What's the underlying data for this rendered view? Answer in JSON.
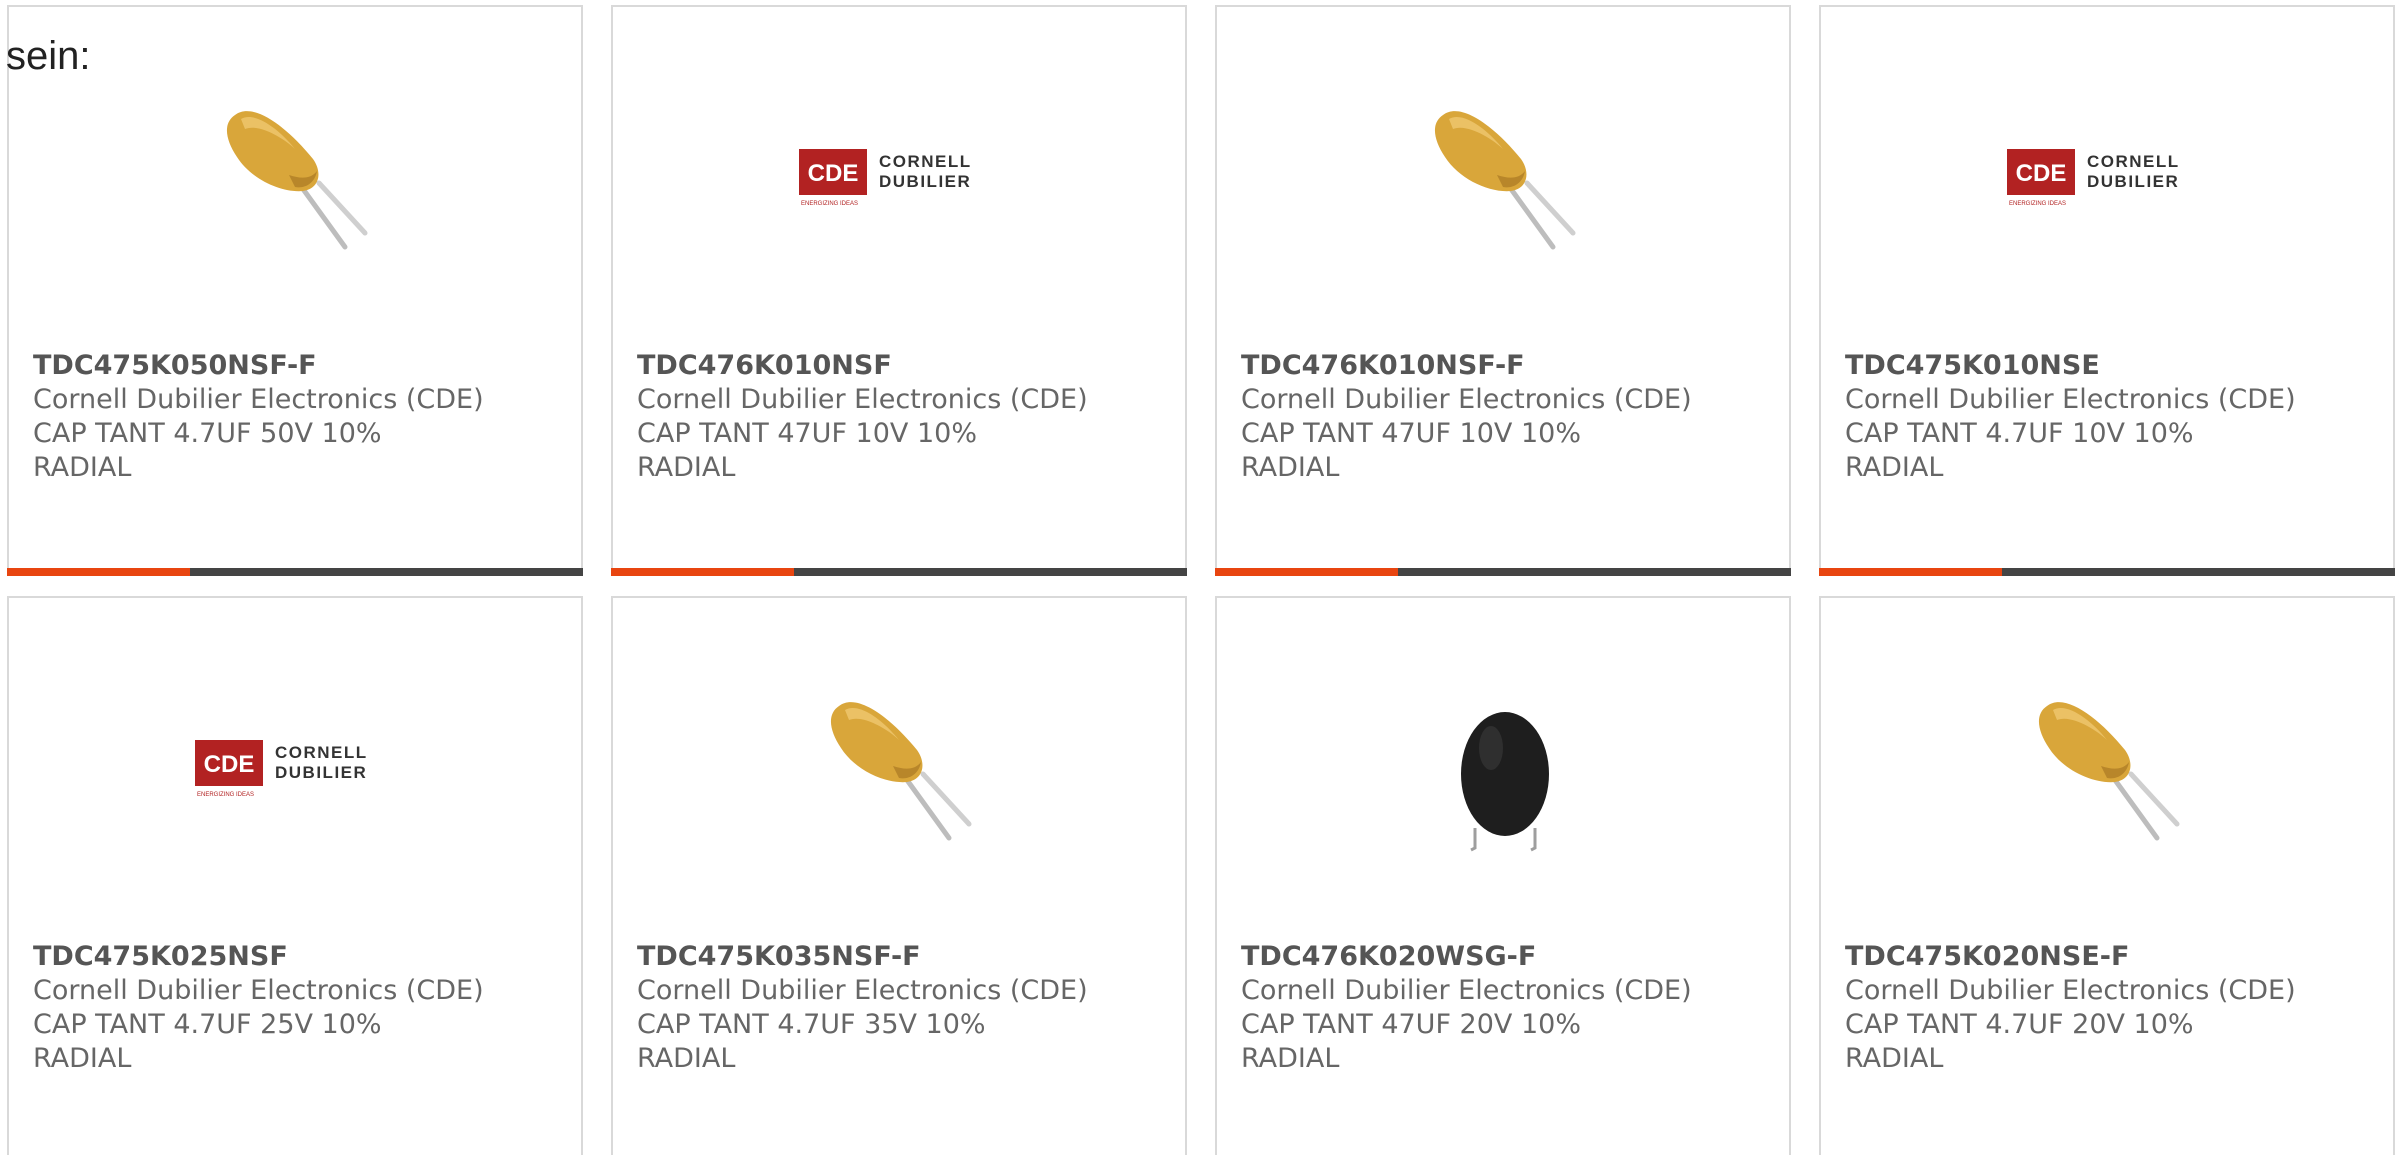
{
  "intro_text": "sein:",
  "colors": {
    "accent": "#e84510",
    "bar": "#444444",
    "border": "#d9d9d9",
    "text": "#666666",
    "cde_red": "#b22222"
  },
  "cards": [
    {
      "part": "TDC475K050NSF-F",
      "manufacturer": "Cornell Dubilier Electronics (CDE)",
      "description": "CAP TANT 4.7UF 50V 10%\nRADIAL",
      "image": "tantalum-capacitor-icon"
    },
    {
      "part": "TDC476K010NSF",
      "manufacturer": "Cornell Dubilier Electronics (CDE)",
      "description": "CAP TANT 47UF 10V 10%\nRADIAL",
      "image": "cde-logo-icon"
    },
    {
      "part": "TDC476K010NSF-F",
      "manufacturer": "Cornell Dubilier Electronics (CDE)",
      "description": "CAP TANT 47UF 10V 10%\nRADIAL",
      "image": "tantalum-capacitor-icon"
    },
    {
      "part": "TDC475K010NSE",
      "manufacturer": "Cornell Dubilier Electronics (CDE)",
      "description": "CAP TANT 4.7UF 10V 10%\nRADIAL",
      "image": "cde-logo-icon"
    },
    {
      "part": "TDC475K025NSF",
      "manufacturer": "Cornell Dubilier Electronics (CDE)",
      "description": "CAP TANT 4.7UF 25V 10%\nRADIAL",
      "image": "cde-logo-icon"
    },
    {
      "part": "TDC475K035NSF-F",
      "manufacturer": "Cornell Dubilier Electronics (CDE)",
      "description": "CAP TANT 4.7UF 35V 10%\nRADIAL",
      "image": "tantalum-capacitor-icon"
    },
    {
      "part": "TDC476K020WSG-F",
      "manufacturer": "Cornell Dubilier Electronics (CDE)",
      "description": "CAP TANT 47UF 20V 10%\nRADIAL",
      "image": "black-capacitor-icon"
    },
    {
      "part": "TDC475K020NSE-F",
      "manufacturer": "Cornell Dubilier Electronics (CDE)",
      "description": "CAP TANT 4.7UF 20V 10%\nRADIAL",
      "image": "tantalum-capacitor-icon"
    }
  ],
  "cde_logo": {
    "mark": "CDE",
    "line1": "CORNELL",
    "line2": "DUBILIER",
    "tagline": "ENERGIZING IDEAS"
  }
}
